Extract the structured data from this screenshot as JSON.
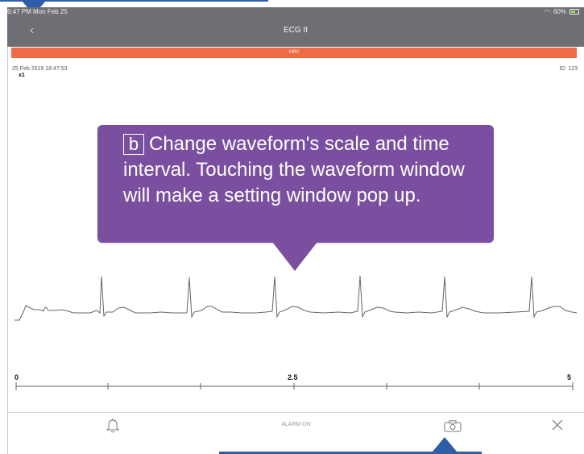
{
  "status_bar": {
    "time": "6:47 PM",
    "date": "Mon Feb 25",
    "battery": "60%"
  },
  "nav": {
    "back_label": "‹",
    "title": "ECG II"
  },
  "alarm_banner": {
    "text": "HR!!"
  },
  "meta": {
    "datetime": "25 Feb 2019 18:47:53",
    "scale": "x1",
    "id": "ID: 123"
  },
  "time_axis": {
    "start": "0",
    "mid": "2.5",
    "end": "5"
  },
  "bottom_bar": {
    "alarm_status": "ALARM ON"
  },
  "callout": {
    "badge": "b",
    "text": "Change waveform's scale and time interval. Touching the waveform window will make a setting window pop up."
  },
  "colors": {
    "header": "#6d6f75",
    "alarm": "#f06a45",
    "callout": "#7b4f9f",
    "marker": "#2f5ea8"
  }
}
